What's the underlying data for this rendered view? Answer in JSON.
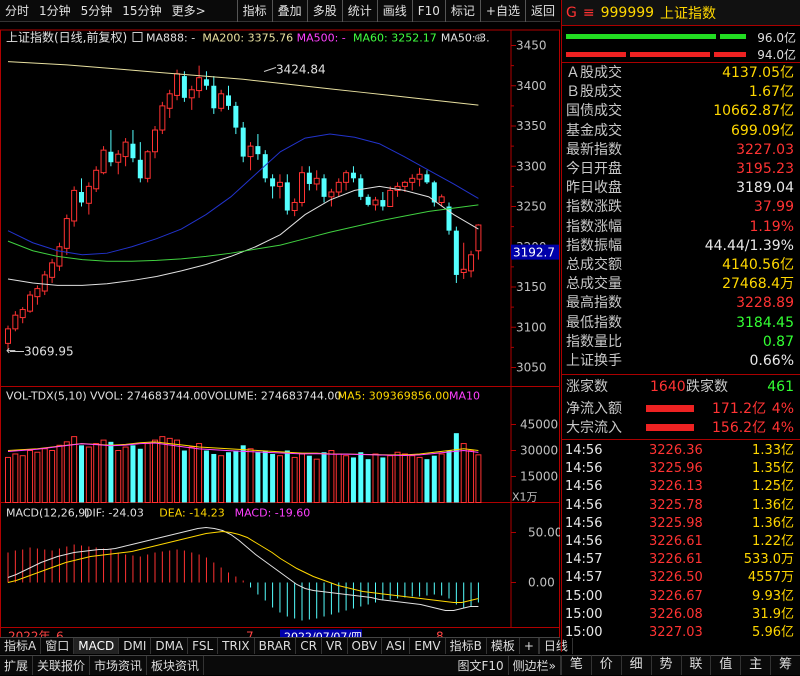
{
  "toolbar": {
    "items": [
      "分时",
      "1分钟",
      "5分钟",
      "15分钟",
      "更多>"
    ],
    "right_items": [
      "指标",
      "叠加",
      "多股",
      "统计",
      "画线",
      "F10",
      "标记",
      "+自选",
      "返回"
    ]
  },
  "chart": {
    "title": "上证指数(日线,前复权)",
    "ma_labels": [
      {
        "text": "MA888: -",
        "color": "#e0e0e0"
      },
      {
        "text": "MA200: 3375.76",
        "color": "#e8e0a0"
      },
      {
        "text": "MA500: -",
        "color": "#ff40ff"
      },
      {
        "text": "MA60: 3252.17",
        "color": "#40ff40"
      },
      {
        "text": "MA50: 3.",
        "color": "#e0e0e0"
      }
    ],
    "high_label": "3424.84",
    "low_label": "3069.95",
    "current_price_tag": "3192.7",
    "price_ticks": [
      "3450",
      "3400",
      "3350",
      "3300",
      "3250",
      "3200",
      "3150",
      "3100",
      "3050"
    ],
    "vol_title": "VOL-TDX(5,10)",
    "vol_labels": [
      {
        "text": "VVOL: 274683744.00",
        "color": "#e0e0e0"
      },
      {
        "text": "VOLUME: 274683744.00",
        "color": "#e0e0e0"
      },
      {
        "text": "MA5: 309369856.00",
        "color": "#ffd700"
      },
      {
        "text": "MA10",
        "color": "#ff40ff"
      }
    ],
    "vol_ticks": [
      "45000",
      "30000",
      "15000"
    ],
    "vol_unit": "X1万",
    "macd_title": "MACD(12,26,9)",
    "macd_labels": [
      {
        "text": "DIF: -24.03",
        "color": "#e0e0e0"
      },
      {
        "text": "DEA: -14.23",
        "color": "#ffd700"
      },
      {
        "text": "MACD: -19.60",
        "color": "#ff40ff"
      }
    ],
    "macd_ticks": [
      "50.00",
      "0.00"
    ],
    "date_labels": {
      "year": "2022年",
      "m6": "6",
      "m7": "7",
      "sel": "2022/07/07/四",
      "m8": "8"
    }
  },
  "bottom_tabs": [
    "指标A",
    "窗口",
    "MACD",
    "DMI",
    "DMA",
    "FSL",
    "TRIX",
    "BRAR",
    "CR",
    "VR",
    "OBV",
    "ASI",
    "EMV",
    "指标B",
    "模板",
    "+"
  ],
  "period_label": "日线",
  "status_tabs": [
    "扩展",
    "关联报价",
    "市场资讯",
    "板块资讯"
  ],
  "status_right": [
    "图文F10",
    "侧边栏»"
  ],
  "right_tabs": [
    "笔",
    "价",
    "细",
    "势",
    "联",
    "值",
    "主",
    "筹"
  ],
  "quote": {
    "header_icon": "G",
    "menu_icon": "≡",
    "code": "999999",
    "name": "上证指数",
    "bar1_val": "96.0亿",
    "bar2_val": "94.0亿",
    "stats": [
      {
        "label": "Ａ股成交",
        "value": "4137.05亿",
        "color": "yel"
      },
      {
        "label": "Ｂ股成交",
        "value": "1.67亿",
        "color": "yel"
      },
      {
        "label": "国债成交",
        "value": "10662.87亿",
        "color": "yel"
      },
      {
        "label": "基金成交",
        "value": "699.09亿",
        "color": "yel"
      },
      {
        "label": "最新指数",
        "value": "3227.03",
        "color": "red"
      },
      {
        "label": "今日开盘",
        "value": "3195.23",
        "color": "red"
      },
      {
        "label": "昨日收盘",
        "value": "3189.04",
        "color": "wht"
      },
      {
        "label": "指数涨跌",
        "value": "37.99",
        "color": "red"
      },
      {
        "label": "指数涨幅",
        "value": "1.19%",
        "color": "red"
      },
      {
        "label": "指数振幅",
        "value": "44.44/1.39%",
        "color": "wht"
      },
      {
        "label": "总成交额",
        "value": "4140.56亿",
        "color": "yel"
      },
      {
        "label": "总成交量",
        "value": "27468.4万",
        "color": "yel"
      },
      {
        "label": "最高指数",
        "value": "3228.89",
        "color": "red"
      },
      {
        "label": "最低指数",
        "value": "3184.45",
        "color": "grn"
      },
      {
        "label": "指数量比",
        "value": "0.87",
        "color": "grn"
      },
      {
        "label": "上证换手",
        "value": "0.66%",
        "color": "wht"
      }
    ],
    "up_label": "涨家数",
    "up_count": "1640",
    "down_label": "跌家数",
    "down_count": "461",
    "net_in_label": "净流入额",
    "net_in_val": "171.2亿",
    "net_in_pct": "4%",
    "block_in_label": "大宗流入",
    "block_in_val": "156.2亿",
    "block_in_pct": "4%",
    "ticks": [
      {
        "t": "14:56",
        "p": "3226.36",
        "v": "1.33亿"
      },
      {
        "t": "14:56",
        "p": "3225.96",
        "v": "1.35亿"
      },
      {
        "t": "14:56",
        "p": "3226.13",
        "v": "1.25亿"
      },
      {
        "t": "14:56",
        "p": "3225.78",
        "v": "1.36亿"
      },
      {
        "t": "14:56",
        "p": "3225.98",
        "v": "1.36亿"
      },
      {
        "t": "14:56",
        "p": "3226.61",
        "v": "1.22亿"
      },
      {
        "t": "14:57",
        "p": "3226.61",
        "v": "533.0万"
      },
      {
        "t": "14:57",
        "p": "3226.50",
        "v": "4557万"
      },
      {
        "t": "15:00",
        "p": "3226.67",
        "v": "9.93亿"
      },
      {
        "t": "15:00",
        "p": "3226.08",
        "v": "31.9亿"
      },
      {
        "t": "15:00",
        "p": "3227.03",
        "v": "5.96亿"
      }
    ]
  },
  "colors": {
    "up": "#ff3232",
    "down": "#54ffff",
    "bg": "#000000",
    "frame": "#b00000"
  }
}
